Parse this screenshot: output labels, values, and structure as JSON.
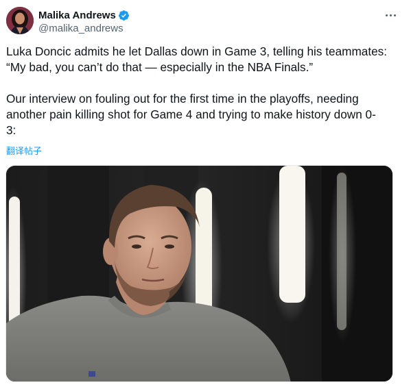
{
  "author": {
    "display_name": "Malika Andrews",
    "handle": "@malika_andrews",
    "verified_icon": "verified-badge-icon",
    "avatar_icon": "avatar-photo"
  },
  "tweet": {
    "lines": [
      "Luka Doncic admits he let Dallas down in Game 3, telling his teammates:",
      "“My bad, you can’t do that — especially in the NBA Finals.”",
      "Our interview on fouling out for the first time in the playoffs, needing",
      "another pain killing shot for Game 4 and trying to make history down 0-",
      "3:"
    ],
    "translate_label": "翻译帖子"
  },
  "media": {
    "type": "video-thumbnail"
  },
  "colors": {
    "text": "#0f1419",
    "secondary": "#536471",
    "link": "#1d9bf0",
    "verified": "#1d9bf0"
  }
}
